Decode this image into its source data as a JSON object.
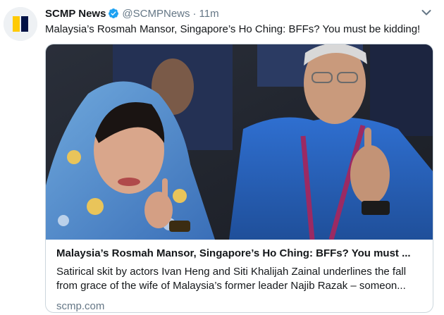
{
  "tweet": {
    "author_name": "SCMP News",
    "handle": "@SCMPNews",
    "separator": "·",
    "time": "11m",
    "text": "Malaysia’s Rosmah Mansor, Singapore’s Ho Ching: BFFs? You must be kidding!"
  },
  "card": {
    "title": "Malaysia’s Rosmah Mansor, Singapore’s Ho Ching: BFFs? You must ...",
    "description": "Satirical skit by actors Ivan Heng and Siti Khalijah Zainal underlines the fall from grace of the wife of Malaysia’s former leader Najib Razak – someon...",
    "domain": "scmp.com"
  },
  "icons": {
    "avatar": "scmp-logo",
    "verified": "verified-badge-icon",
    "menu": "chevron-down-icon"
  },
  "colors": {
    "verified_blue": "#1da1f2",
    "secondary_text": "#657786",
    "card_border": "#ccd6dd",
    "logo_yellow": "#ffca05",
    "logo_navy": "#001246"
  }
}
